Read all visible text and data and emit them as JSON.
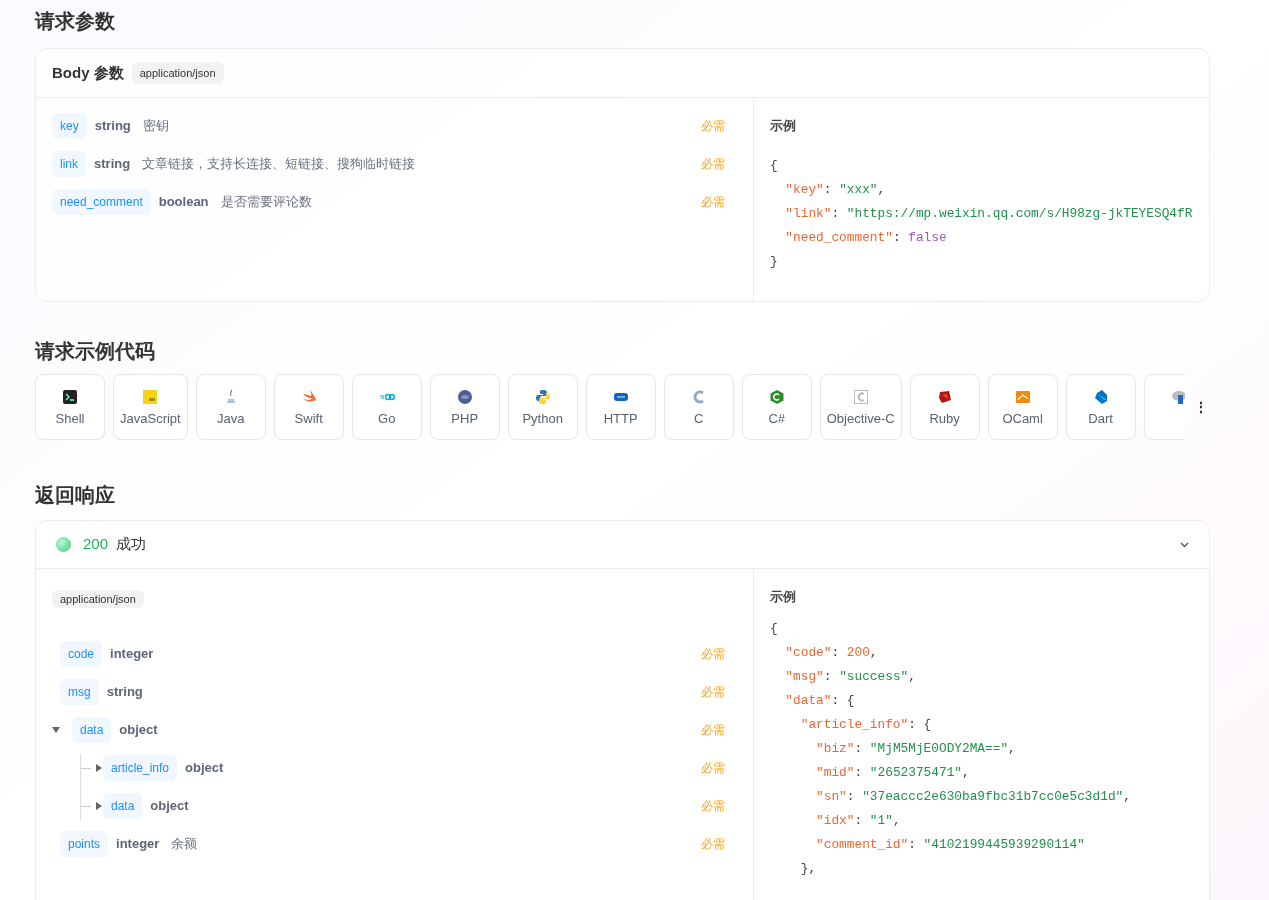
{
  "request": {
    "title": "请求参数",
    "body": {
      "title": "Body 参数",
      "content_type": "application/json",
      "params": [
        {
          "name": "key",
          "type": "string",
          "description": "密钥",
          "required": "必需"
        },
        {
          "name": "link",
          "type": "string",
          "description": "文章链接，支持长连接、短链接、搜狗临时链接",
          "required": "必需"
        },
        {
          "name": "need_comment",
          "type": "boolean",
          "description": "是否需要评论数",
          "required": "必需"
        }
      ],
      "example": {
        "title": "示例",
        "lines": [
          [
            {
              "kind": "punct",
              "text": "{"
            }
          ],
          [
            {
              "kind": "key",
              "text": "  \"key\""
            },
            {
              "kind": "punct",
              "text": ": "
            },
            {
              "kind": "string",
              "text": "\"xxx\""
            },
            {
              "kind": "punct",
              "text": ","
            }
          ],
          [
            {
              "kind": "key",
              "text": "  \"link\""
            },
            {
              "kind": "punct",
              "text": ": "
            },
            {
              "kind": "string",
              "text": "\"https://mp.weixin.qq.com/s/H98zg-jkTEYESQ4fR"
            }
          ],
          [
            {
              "kind": "key",
              "text": "  \"need_comment\""
            },
            {
              "kind": "punct",
              "text": ": "
            },
            {
              "kind": "bool",
              "text": "false"
            }
          ],
          [
            {
              "kind": "punct",
              "text": "}"
            }
          ]
        ]
      }
    }
  },
  "code_samples": {
    "title": "请求示例代码",
    "languages": [
      {
        "kind": "shell",
        "label": "Shell"
      },
      {
        "kind": "js",
        "label": "JavaScript"
      },
      {
        "kind": "java",
        "label": "Java"
      },
      {
        "kind": "swift",
        "label": "Swift"
      },
      {
        "kind": "go",
        "label": "Go"
      },
      {
        "kind": "php",
        "label": "PHP"
      },
      {
        "kind": "python",
        "label": "Python"
      },
      {
        "kind": "http",
        "label": "HTTP"
      },
      {
        "kind": "c",
        "label": "C"
      },
      {
        "kind": "csharp",
        "label": "C#"
      },
      {
        "kind": "objc",
        "label": "Objective-C"
      },
      {
        "kind": "ruby",
        "label": "Ruby"
      },
      {
        "kind": "ocaml",
        "label": "OCaml"
      },
      {
        "kind": "dart",
        "label": "Dart"
      },
      {
        "kind": "r"
      }
    ],
    "more": "⋮"
  },
  "response": {
    "title": "返回响应",
    "status": {
      "code": "200",
      "text": "成功",
      "expanded": true
    },
    "content_type": "application/json",
    "fields": [
      {
        "name": "code",
        "type": "integer",
        "required": "必需"
      },
      {
        "name": "msg",
        "type": "string",
        "required": "必需"
      },
      {
        "name": "data",
        "type": "object",
        "required": "必需",
        "expanded": true,
        "children": [
          {
            "name": "article_info",
            "type": "object",
            "required": "必需",
            "expanded": false
          },
          {
            "name": "data",
            "type": "object",
            "required": "必需",
            "expanded": false
          }
        ]
      },
      {
        "name": "points",
        "type": "integer",
        "description": "余额",
        "required": "必需"
      }
    ],
    "example": {
      "title": "示例",
      "lines": [
        [
          {
            "kind": "punct",
            "text": "{"
          }
        ],
        [
          {
            "kind": "key",
            "text": "  \"code\""
          },
          {
            "kind": "punct",
            "text": ": "
          },
          {
            "kind": "number",
            "text": "200"
          },
          {
            "kind": "punct",
            "text": ","
          }
        ],
        [
          {
            "kind": "key",
            "text": "  \"msg\""
          },
          {
            "kind": "punct",
            "text": ": "
          },
          {
            "kind": "string",
            "text": "\"success\""
          },
          {
            "kind": "punct",
            "text": ","
          }
        ],
        [
          {
            "kind": "key",
            "text": "  \"data\""
          },
          {
            "kind": "punct",
            "text": ": {"
          }
        ],
        [
          {
            "kind": "key",
            "text": "    \"article_info\""
          },
          {
            "kind": "punct",
            "text": ": {"
          }
        ],
        [
          {
            "kind": "key",
            "text": "      \"biz\""
          },
          {
            "kind": "punct",
            "text": ": "
          },
          {
            "kind": "string",
            "text": "\"MjM5MjE0ODY2MA==\""
          },
          {
            "kind": "punct",
            "text": ","
          }
        ],
        [
          {
            "kind": "key",
            "text": "      \"mid\""
          },
          {
            "kind": "punct",
            "text": ": "
          },
          {
            "kind": "string",
            "text": "\"2652375471\""
          },
          {
            "kind": "punct",
            "text": ","
          }
        ],
        [
          {
            "kind": "key",
            "text": "      \"sn\""
          },
          {
            "kind": "punct",
            "text": ": "
          },
          {
            "kind": "string",
            "text": "\"37eaccc2e630ba9fbc31b7cc0e5c3d1d\""
          },
          {
            "kind": "punct",
            "text": ","
          }
        ],
        [
          {
            "kind": "key",
            "text": "      \"idx\""
          },
          {
            "kind": "punct",
            "text": ": "
          },
          {
            "kind": "string",
            "text": "\"1\""
          },
          {
            "kind": "punct",
            "text": ","
          }
        ],
        [
          {
            "kind": "key",
            "text": "      \"comment_id\""
          },
          {
            "kind": "punct",
            "text": ": "
          },
          {
            "kind": "string",
            "text": "\"4102199445939290114\""
          }
        ],
        [
          {
            "kind": "punct",
            "text": "    },"
          }
        ]
      ]
    }
  }
}
